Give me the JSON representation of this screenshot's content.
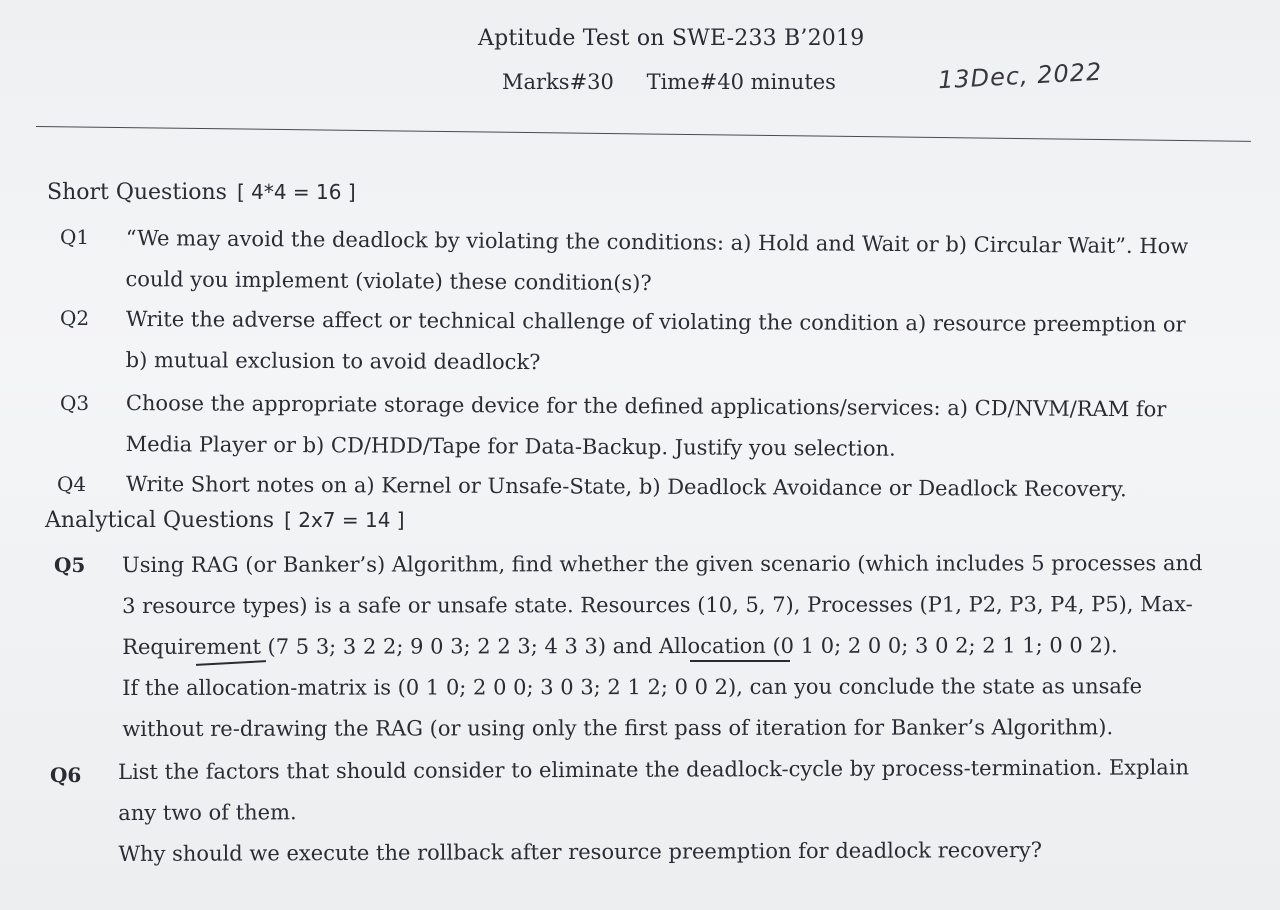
{
  "header": {
    "title": "Aptitude Test on SWE-233 B’2019",
    "marks": "Marks#30",
    "time": "Time#40 minutes",
    "date": "13Dec, 2022"
  },
  "sections": {
    "short": {
      "heading": "Short Questions",
      "marks": "[ 4*4 = 16 ]"
    },
    "analytical": {
      "heading": "Analytical Questions",
      "marks": "[ 2x7 = 14 ]"
    }
  },
  "questions": {
    "q1": {
      "label": "Q1",
      "line1": "“We may avoid the deadlock by violating the conditions: a) Hold and Wait or b) Circular Wait”. How",
      "line2": "could you implement (violate) these condition(s)?"
    },
    "q2": {
      "label": "Q2",
      "line1": "Write the adverse affect or technical challenge of violating the condition a) resource preemption or",
      "line2": "b) mutual exclusion to avoid deadlock?"
    },
    "q3": {
      "label": "Q3",
      "line1": "Choose the appropriate storage device for the defined applications/services: a) CD/NVM/RAM for",
      "line2": "Media Player or b) CD/HDD/Tape for Data-Backup. Justify you selection."
    },
    "q4": {
      "label": "Q4",
      "line1": "Write Short notes on a) Kernel or Unsafe-State, b) Deadlock Avoidance or Deadlock Recovery."
    },
    "q5": {
      "label": "Q5",
      "line1": "Using RAG (or Banker’s) Algorithm, find whether the given scenario (which includes 5 processes and",
      "line2": "3 resource types) is a safe or unsafe state. Resources (10, 5, 7), Processes (P1, P2, P3, P4, P5), Max-",
      "line3": "Requirement (7 5 3; 3 2 2; 9 0 3; 2 2 3; 4 3 3) and Allocation (0 1 0; 2 0 0; 3 0 2; 2 1 1; 0 0 2).",
      "line4": "If the allocation-matrix is (0 1 0; 2 0 0; 3 0 3; 2 1 2; 0 0 2), can you conclude the state as unsafe",
      "line5": "without re-drawing the RAG (or using only the first pass of iteration for Banker’s Algorithm)."
    },
    "q6": {
      "label": "Q6",
      "line1": "List the factors that should consider to eliminate the deadlock-cycle by process-termination. Explain",
      "line2": "any two of them.",
      "line3": "Why should we execute the rollback after resource preemption for deadlock recovery?"
    }
  }
}
